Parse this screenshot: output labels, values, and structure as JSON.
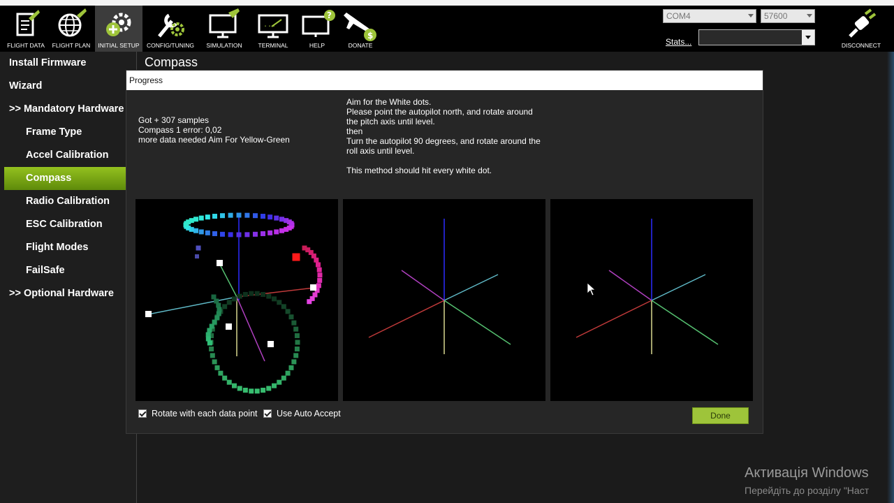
{
  "toolbar": {
    "items": [
      {
        "label": "FLIGHT DATA",
        "icon": "clipboard-icon"
      },
      {
        "label": "FLIGHT PLAN",
        "icon": "globe-icon"
      },
      {
        "label": "INITIAL SETUP",
        "icon": "gear-plus-icon"
      },
      {
        "label": "CONFIG/TUNING",
        "icon": "wrench-gear-icon"
      },
      {
        "label": "SIMULATION",
        "icon": "monitor-plane-icon"
      },
      {
        "label": "TERMINAL",
        "icon": "terminal-icon"
      },
      {
        "label": "HELP",
        "icon": "help-monitor-icon"
      },
      {
        "label": "DONATE",
        "icon": "plane-dollar-icon"
      }
    ],
    "active_index": 2,
    "com_port": "COM4",
    "baud_rate": "57600",
    "stats_label": "Stats...",
    "connect_label": "DISCONNECT"
  },
  "sidebar": {
    "items": [
      {
        "label": "Install Firmware",
        "indent": 0
      },
      {
        "label": "Wizard",
        "indent": 0
      },
      {
        "label": ">> Mandatory Hardware",
        "indent": 0
      },
      {
        "label": "Frame Type",
        "indent": 1
      },
      {
        "label": "Accel Calibration",
        "indent": 1
      },
      {
        "label": "Compass",
        "indent": 1
      },
      {
        "label": "Radio Calibration",
        "indent": 1
      },
      {
        "label": "ESC Calibration",
        "indent": 1
      },
      {
        "label": "Flight Modes",
        "indent": 1
      },
      {
        "label": "FailSafe",
        "indent": 1
      },
      {
        "label": ">> Optional Hardware",
        "indent": 0
      }
    ],
    "selected_index": 5
  },
  "page": {
    "title": "Compass"
  },
  "dialog": {
    "title": "Progress",
    "status_lines": [
      "Got + 307 samples",
      "Compass 1 error: 0,02",
      "more data needed Aim For Yellow-Green"
    ],
    "instruction_lines": [
      "Aim for the White dots.",
      "Please point the autopilot north, and rotate around",
      "the pitch axis until level.",
      "then",
      "Turn the autopilot 90 degrees, and rotate around the",
      "roll axis until level.",
      "",
      "This method should hit every white dot."
    ],
    "checkbox_rotate": "Rotate with each data point",
    "checkbox_auto_accept": "Use Auto Accept",
    "done_label": "Done"
  },
  "watermark": {
    "line1": "Активація Windows",
    "line2": "Перейдіть до розділу \"Наст"
  },
  "colors": {
    "accent": "#8fbf1f",
    "background": "#1b1b1b",
    "panel": "#000000"
  }
}
